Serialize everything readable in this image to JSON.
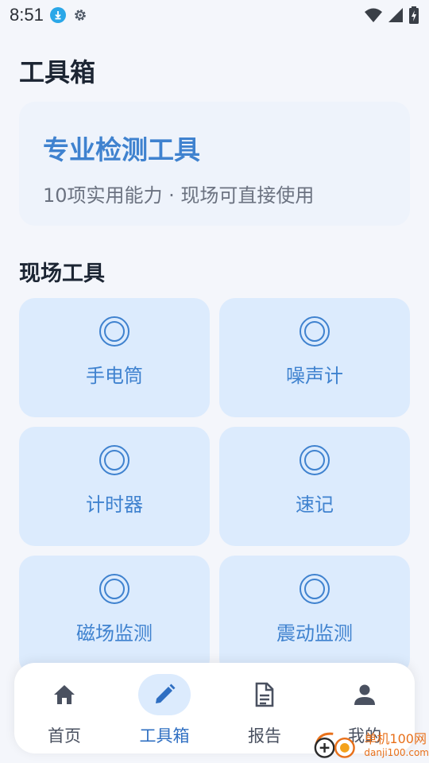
{
  "status_bar": {
    "time": "8:51",
    "icons": [
      "download-icon",
      "gear-icon",
      "wifi-icon",
      "signal-icon",
      "battery-charging-icon"
    ]
  },
  "header": {
    "title": "工具箱"
  },
  "hero": {
    "title": "专业检测工具",
    "subtitle": "10项实用能力 · 现场可直接使用"
  },
  "section": {
    "title": "现场工具"
  },
  "tools": [
    {
      "label": "手电筒",
      "icon": "ring-icon"
    },
    {
      "label": "噪声计",
      "icon": "ring-icon"
    },
    {
      "label": "计时器",
      "icon": "ring-icon"
    },
    {
      "label": "速记",
      "icon": "ring-icon"
    },
    {
      "label": "磁场监测",
      "icon": "ring-icon"
    },
    {
      "label": "震动监测",
      "icon": "ring-icon"
    }
  ],
  "bottom_nav": {
    "items": [
      {
        "label": "首页",
        "icon": "home-icon",
        "active": false
      },
      {
        "label": "工具箱",
        "icon": "pencil-icon",
        "active": true
      },
      {
        "label": "报告",
        "icon": "document-icon",
        "active": false
      },
      {
        "label": "我的",
        "icon": "person-icon",
        "active": false
      }
    ]
  },
  "watermark": {
    "name": "单机100网",
    "url": "danji100.com"
  },
  "colors": {
    "accent": "#3f82cf",
    "card_bg": "#dcebfd",
    "page_bg": "#f4f6fb"
  }
}
